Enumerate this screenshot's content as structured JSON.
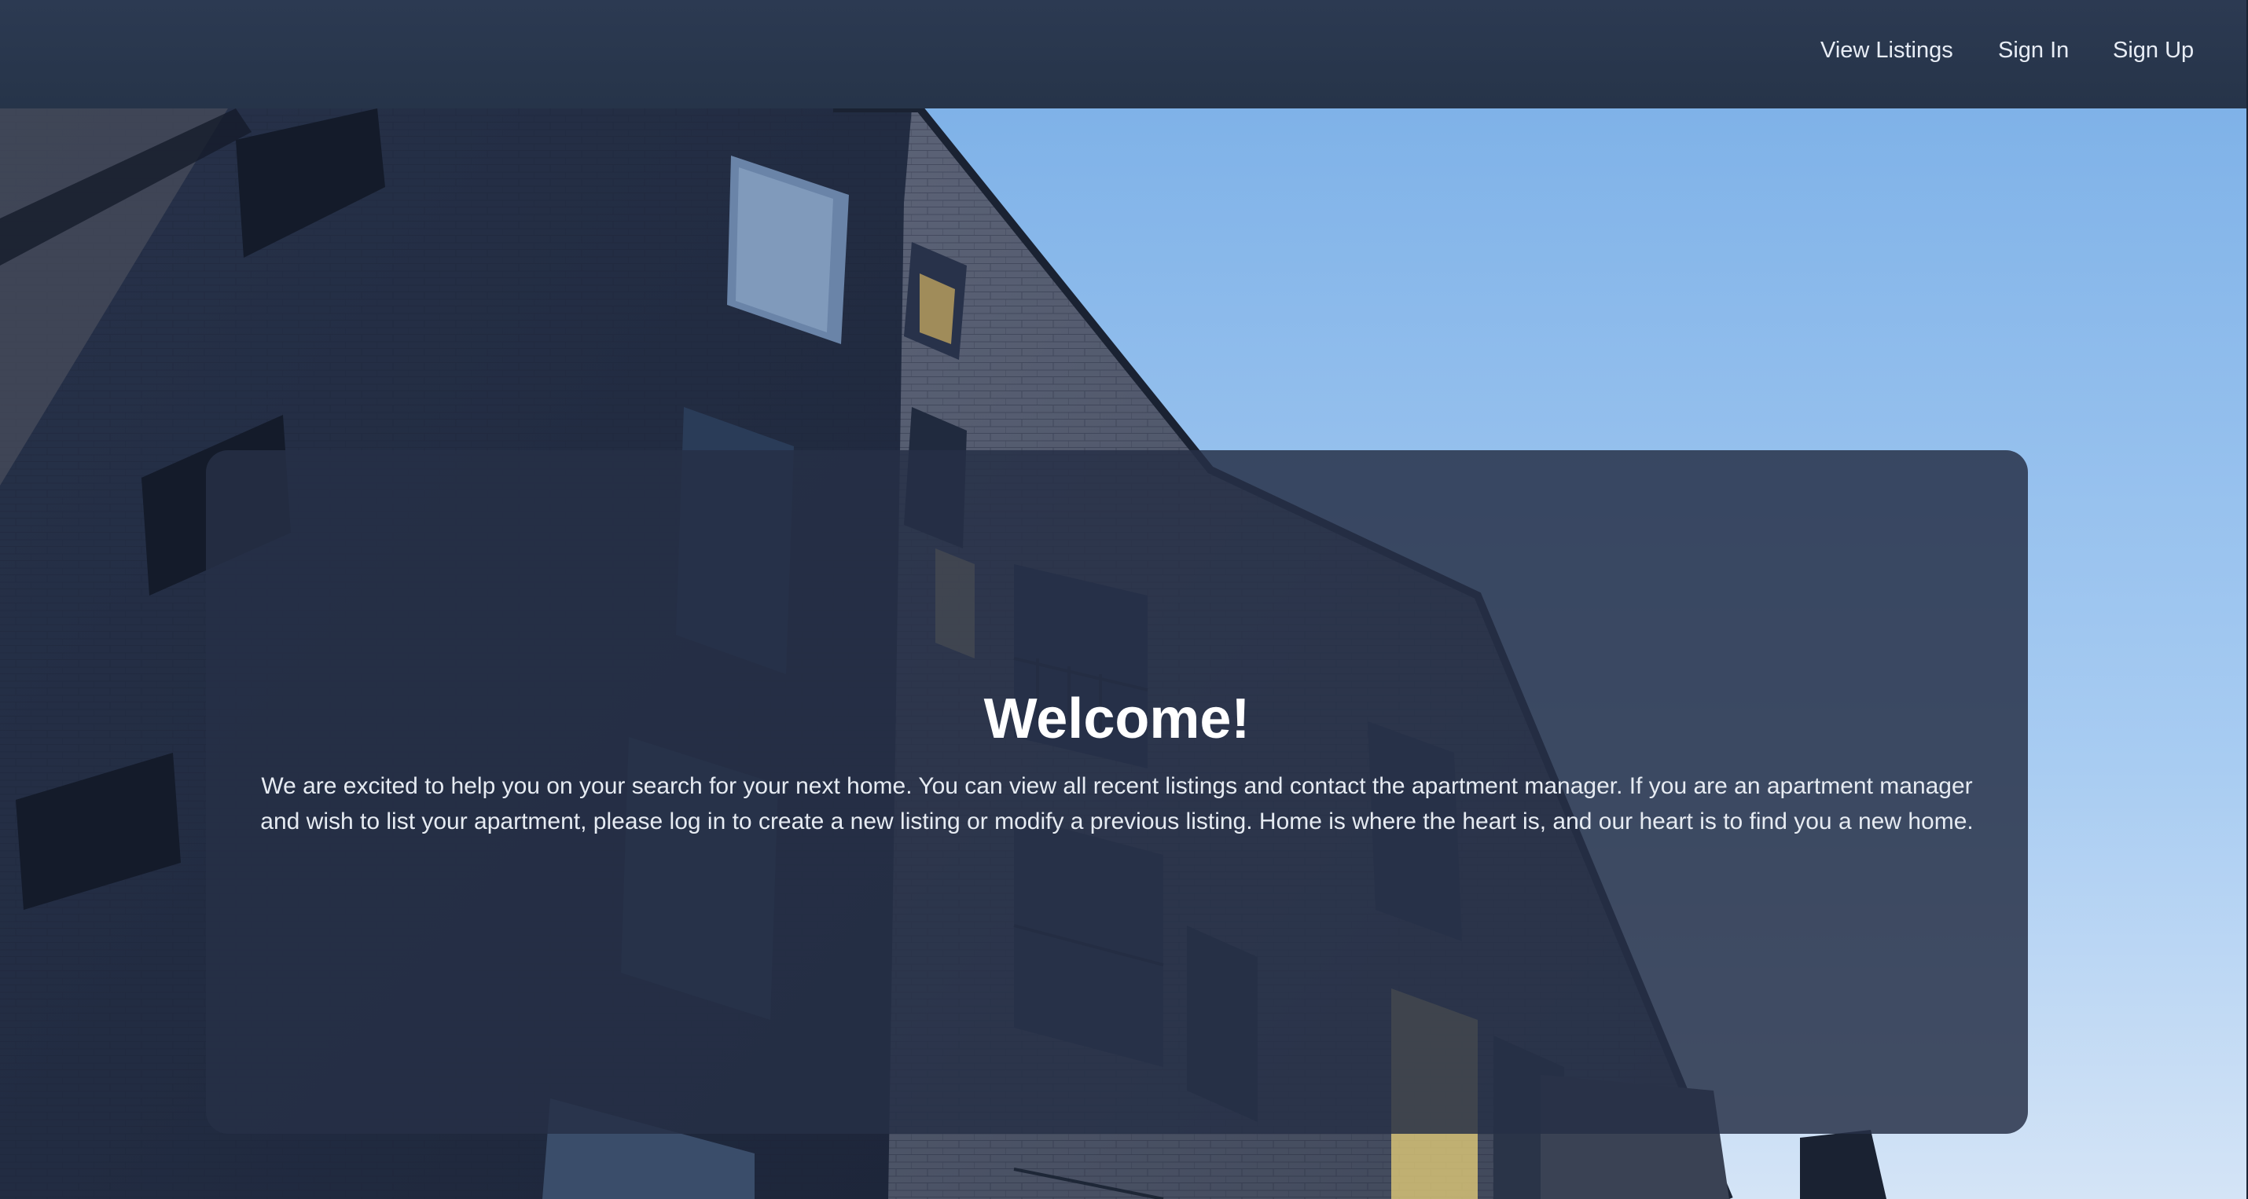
{
  "navbar": {
    "links": [
      {
        "label": "View Listings"
      },
      {
        "label": "Sign In"
      },
      {
        "label": "Sign Up"
      }
    ]
  },
  "hero": {
    "image": "apartment-building-photo"
  },
  "welcome_card": {
    "title": "Welcome!",
    "body": "We are excited to help you on your search for your next home. You can view all recent listings and contact the apartment manager. If you are an apartment manager and wish to list your apartment, please log in to create a new listing or modify a previous listing. Home is where the heart is, and our heart is to find you a new home."
  },
  "colors": {
    "navbar": "#2a3850",
    "card": "#263046",
    "sky": "#9cc4f2",
    "text": "#ffffff"
  }
}
